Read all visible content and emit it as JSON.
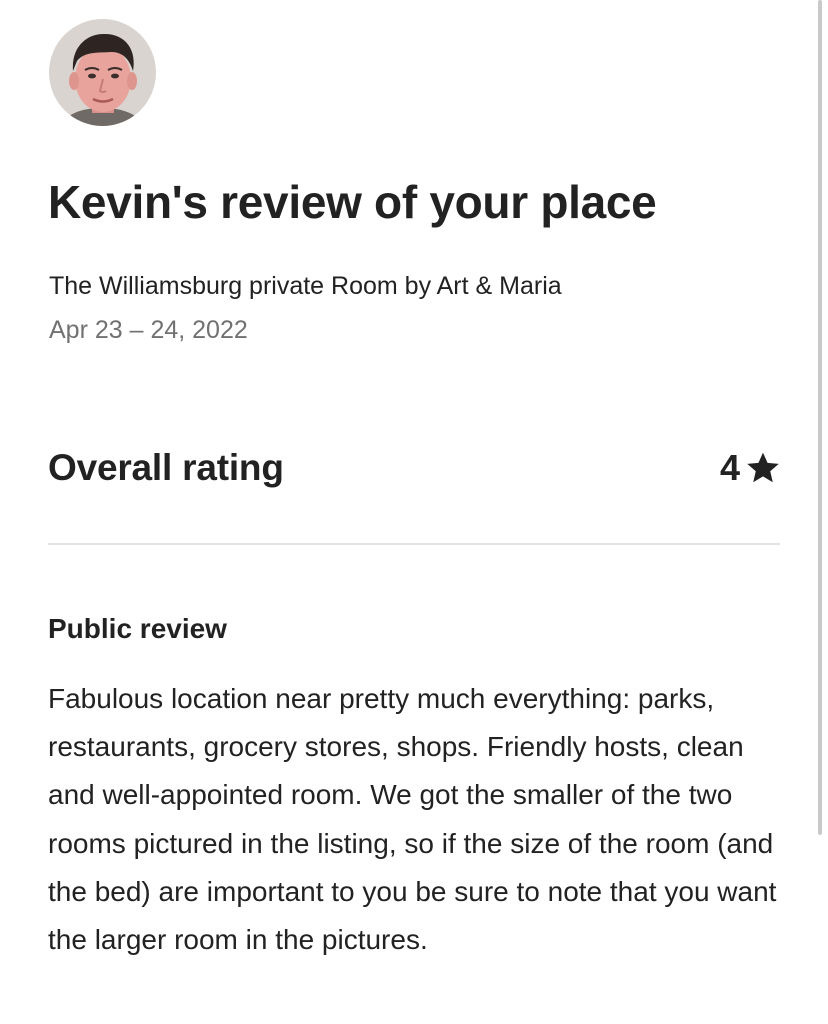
{
  "review": {
    "title": "Kevin's review of your place",
    "listing_name": "The Williamsburg private Room by Art & Maria",
    "dates": "Apr 23 – 24, 2022",
    "overall_rating": {
      "label": "Overall rating",
      "value": "4",
      "icon": "star-icon"
    },
    "public_review": {
      "heading": "Public review",
      "text": "Fabulous location near pretty much everything: parks, restaurants, grocery stores, shops. Friendly hosts, clean and well-appointed room. We got the smaller of the two rooms pictured in the listing, so if the size of the room (and the bed) are important to you be sure to note that you want the larger room in the pictures."
    }
  },
  "reviewer": {
    "avatar_icon": "avatar"
  },
  "colors": {
    "text_primary": "#222222",
    "text_secondary": "#717171",
    "divider": "#e2e2e2"
  }
}
